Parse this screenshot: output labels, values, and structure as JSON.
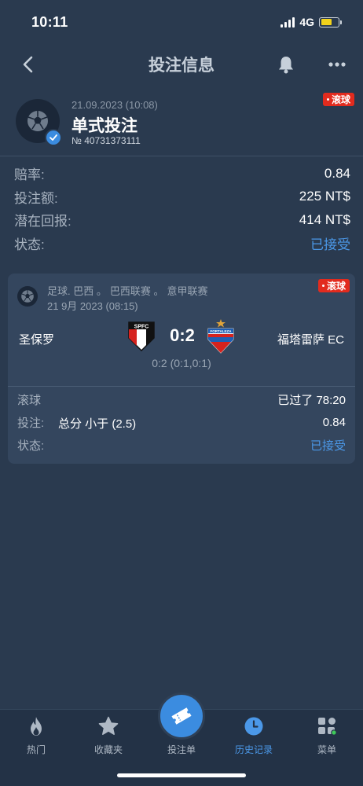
{
  "status_bar": {
    "time": "10:11",
    "network": "4G"
  },
  "nav": {
    "title": "投注信息"
  },
  "bet": {
    "date": "21.09.2023 (10:08)",
    "type": "单式投注",
    "number": "№ 40731373111",
    "live_badge": "滚球"
  },
  "summary": {
    "odds_label": "赔率:",
    "odds_value": "0.84",
    "stake_label": "投注额:",
    "stake_value": "225 NT$",
    "payout_label": "潜在回报:",
    "payout_value": "414 NT$",
    "status_label": "状态:",
    "status_value": "已接受"
  },
  "match": {
    "sport": "足球. 巴西 。",
    "league": "巴西联赛 。",
    "league2": "意甲联赛",
    "date": "21 9月 2023 (08:15)",
    "live_badge": "滚球",
    "home_team": "圣保罗",
    "away_team": "福塔雷萨 EC",
    "home_crest_text": "SPFC",
    "away_crest_text": "FORTALEZA",
    "score": "0:2",
    "score_detail": "0:2 (0:1,0:1)",
    "live_label": "滚球",
    "elapsed": "已过了 78:20",
    "bet_label": "投注:",
    "market": "总分 小于 (2.5)",
    "odds": "0.84",
    "status_label": "状态:",
    "status_value": "已接受"
  },
  "tabs": [
    {
      "label": "热门",
      "icon": "flame-icon"
    },
    {
      "label": "收藏夹",
      "icon": "star-icon"
    },
    {
      "label": "投注单",
      "icon": "ticket-icon"
    },
    {
      "label": "历史记录",
      "icon": "clock-icon"
    },
    {
      "label": "菜单",
      "icon": "grid-icon"
    }
  ],
  "colors": {
    "accent": "#3b8ce0",
    "live": "#e22b1e",
    "background": "#2a3a4f",
    "card": "#34465e"
  }
}
